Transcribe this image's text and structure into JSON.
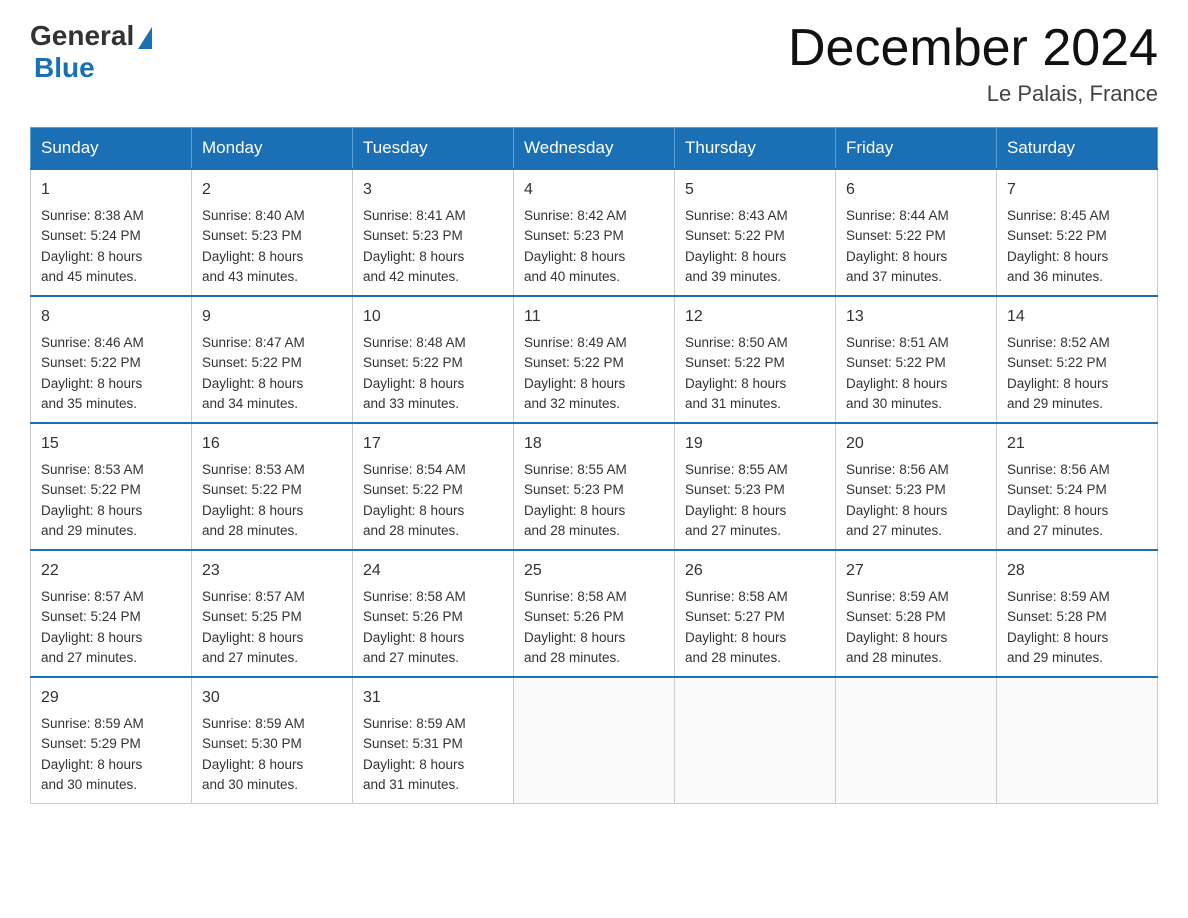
{
  "header": {
    "logo_general": "General",
    "logo_blue": "Blue",
    "title": "December 2024",
    "subtitle": "Le Palais, France"
  },
  "days_of_week": [
    "Sunday",
    "Monday",
    "Tuesday",
    "Wednesday",
    "Thursday",
    "Friday",
    "Saturday"
  ],
  "weeks": [
    [
      {
        "day": "1",
        "sunrise": "8:38 AM",
        "sunset": "5:24 PM",
        "daylight": "8 hours and 45 minutes."
      },
      {
        "day": "2",
        "sunrise": "8:40 AM",
        "sunset": "5:23 PM",
        "daylight": "8 hours and 43 minutes."
      },
      {
        "day": "3",
        "sunrise": "8:41 AM",
        "sunset": "5:23 PM",
        "daylight": "8 hours and 42 minutes."
      },
      {
        "day": "4",
        "sunrise": "8:42 AM",
        "sunset": "5:23 PM",
        "daylight": "8 hours and 40 minutes."
      },
      {
        "day": "5",
        "sunrise": "8:43 AM",
        "sunset": "5:22 PM",
        "daylight": "8 hours and 39 minutes."
      },
      {
        "day": "6",
        "sunrise": "8:44 AM",
        "sunset": "5:22 PM",
        "daylight": "8 hours and 37 minutes."
      },
      {
        "day": "7",
        "sunrise": "8:45 AM",
        "sunset": "5:22 PM",
        "daylight": "8 hours and 36 minutes."
      }
    ],
    [
      {
        "day": "8",
        "sunrise": "8:46 AM",
        "sunset": "5:22 PM",
        "daylight": "8 hours and 35 minutes."
      },
      {
        "day": "9",
        "sunrise": "8:47 AM",
        "sunset": "5:22 PM",
        "daylight": "8 hours and 34 minutes."
      },
      {
        "day": "10",
        "sunrise": "8:48 AM",
        "sunset": "5:22 PM",
        "daylight": "8 hours and 33 minutes."
      },
      {
        "day": "11",
        "sunrise": "8:49 AM",
        "sunset": "5:22 PM",
        "daylight": "8 hours and 32 minutes."
      },
      {
        "day": "12",
        "sunrise": "8:50 AM",
        "sunset": "5:22 PM",
        "daylight": "8 hours and 31 minutes."
      },
      {
        "day": "13",
        "sunrise": "8:51 AM",
        "sunset": "5:22 PM",
        "daylight": "8 hours and 30 minutes."
      },
      {
        "day": "14",
        "sunrise": "8:52 AM",
        "sunset": "5:22 PM",
        "daylight": "8 hours and 29 minutes."
      }
    ],
    [
      {
        "day": "15",
        "sunrise": "8:53 AM",
        "sunset": "5:22 PM",
        "daylight": "8 hours and 29 minutes."
      },
      {
        "day": "16",
        "sunrise": "8:53 AM",
        "sunset": "5:22 PM",
        "daylight": "8 hours and 28 minutes."
      },
      {
        "day": "17",
        "sunrise": "8:54 AM",
        "sunset": "5:22 PM",
        "daylight": "8 hours and 28 minutes."
      },
      {
        "day": "18",
        "sunrise": "8:55 AM",
        "sunset": "5:23 PM",
        "daylight": "8 hours and 28 minutes."
      },
      {
        "day": "19",
        "sunrise": "8:55 AM",
        "sunset": "5:23 PM",
        "daylight": "8 hours and 27 minutes."
      },
      {
        "day": "20",
        "sunrise": "8:56 AM",
        "sunset": "5:23 PM",
        "daylight": "8 hours and 27 minutes."
      },
      {
        "day": "21",
        "sunrise": "8:56 AM",
        "sunset": "5:24 PM",
        "daylight": "8 hours and 27 minutes."
      }
    ],
    [
      {
        "day": "22",
        "sunrise": "8:57 AM",
        "sunset": "5:24 PM",
        "daylight": "8 hours and 27 minutes."
      },
      {
        "day": "23",
        "sunrise": "8:57 AM",
        "sunset": "5:25 PM",
        "daylight": "8 hours and 27 minutes."
      },
      {
        "day": "24",
        "sunrise": "8:58 AM",
        "sunset": "5:26 PM",
        "daylight": "8 hours and 27 minutes."
      },
      {
        "day": "25",
        "sunrise": "8:58 AM",
        "sunset": "5:26 PM",
        "daylight": "8 hours and 28 minutes."
      },
      {
        "day": "26",
        "sunrise": "8:58 AM",
        "sunset": "5:27 PM",
        "daylight": "8 hours and 28 minutes."
      },
      {
        "day": "27",
        "sunrise": "8:59 AM",
        "sunset": "5:28 PM",
        "daylight": "8 hours and 28 minutes."
      },
      {
        "day": "28",
        "sunrise": "8:59 AM",
        "sunset": "5:28 PM",
        "daylight": "8 hours and 29 minutes."
      }
    ],
    [
      {
        "day": "29",
        "sunrise": "8:59 AM",
        "sunset": "5:29 PM",
        "daylight": "8 hours and 30 minutes."
      },
      {
        "day": "30",
        "sunrise": "8:59 AM",
        "sunset": "5:30 PM",
        "daylight": "8 hours and 30 minutes."
      },
      {
        "day": "31",
        "sunrise": "8:59 AM",
        "sunset": "5:31 PM",
        "daylight": "8 hours and 31 minutes."
      },
      null,
      null,
      null,
      null
    ]
  ],
  "labels": {
    "sunrise": "Sunrise:",
    "sunset": "Sunset:",
    "daylight": "Daylight:"
  }
}
